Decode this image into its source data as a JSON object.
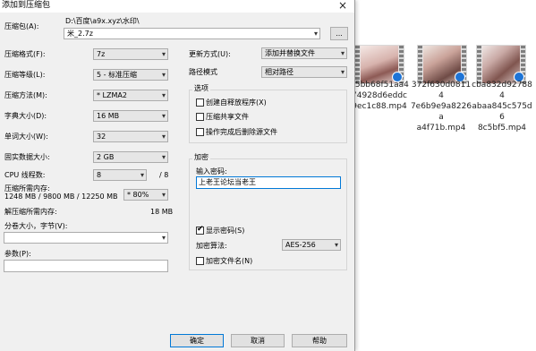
{
  "dialog": {
    "title": "添加到压缩包",
    "close_glyph": "×",
    "archive_label": "压缩包(A):",
    "archive_path": "D:\\百度\\a9x.xyz\\水印\\",
    "archive_name": "米_2.7z",
    "browse_label": "...",
    "format_label": "压缩格式(F):",
    "format_value": "7z",
    "level_label": "压缩等级(L):",
    "level_value": "5 - 标准压缩",
    "method_label": "压缩方法(M):",
    "method_value": "* LZMA2",
    "dict_label": "字典大小(D):",
    "dict_value": "16 MB",
    "word_label": "单词大小(W):",
    "word_value": "32",
    "solid_label": "固实数据大小:",
    "solid_value": "2 GB",
    "threads_label": "CPU 线程数:",
    "threads_value": "8",
    "threads_max": "/ 8",
    "mem_comp_label": "压缩所需内存:",
    "mem_comp_values": "1248 MB / 9800 MB / 12250 MB",
    "mem_pct_value": "* 80%",
    "mem_decomp_label": "解压缩所需内存:",
    "mem_decomp_value": "18 MB",
    "split_label": "分卷大小，字节(V):",
    "split_value": "",
    "params_label": "参数(P):",
    "params_value": "",
    "update_label": "更新方式(U):",
    "update_value": "添加并替换文件",
    "pathmode_label": "路径模式",
    "pathmode_value": "相对路径",
    "options_title": "选项",
    "opt_sfx": "创建自释放程序(X)",
    "opt_shared": "压缩共享文件",
    "opt_delete": "操作完成后删除源文件",
    "encrypt_title": "加密",
    "password_label": "输入密码:",
    "password_value": "上老王论坛当老王",
    "show_password": "显示密码(S)",
    "enc_method_label": "加密算法:",
    "enc_method_value": "AES-256",
    "encrypt_names": "加密文件名(N)",
    "ok": "确定",
    "cancel": "取消",
    "help": "帮助"
  },
  "explorer": {
    "files": [
      {
        "line1": "55bb68f51aa4",
        "line2": "74928d6eddc",
        "line3": "9ec1c88.mp4"
      },
      {
        "line1": "372f630d08114",
        "line2": "7e6b9e9a8226a",
        "line3": "a4f71b.mp4"
      },
      {
        "line1": "cba832d927884",
        "line2": "abaa845c575d6",
        "line3": "8c5bf5.mp4"
      }
    ]
  },
  "icons": {
    "dropdown": "▾",
    "check": "✔"
  }
}
